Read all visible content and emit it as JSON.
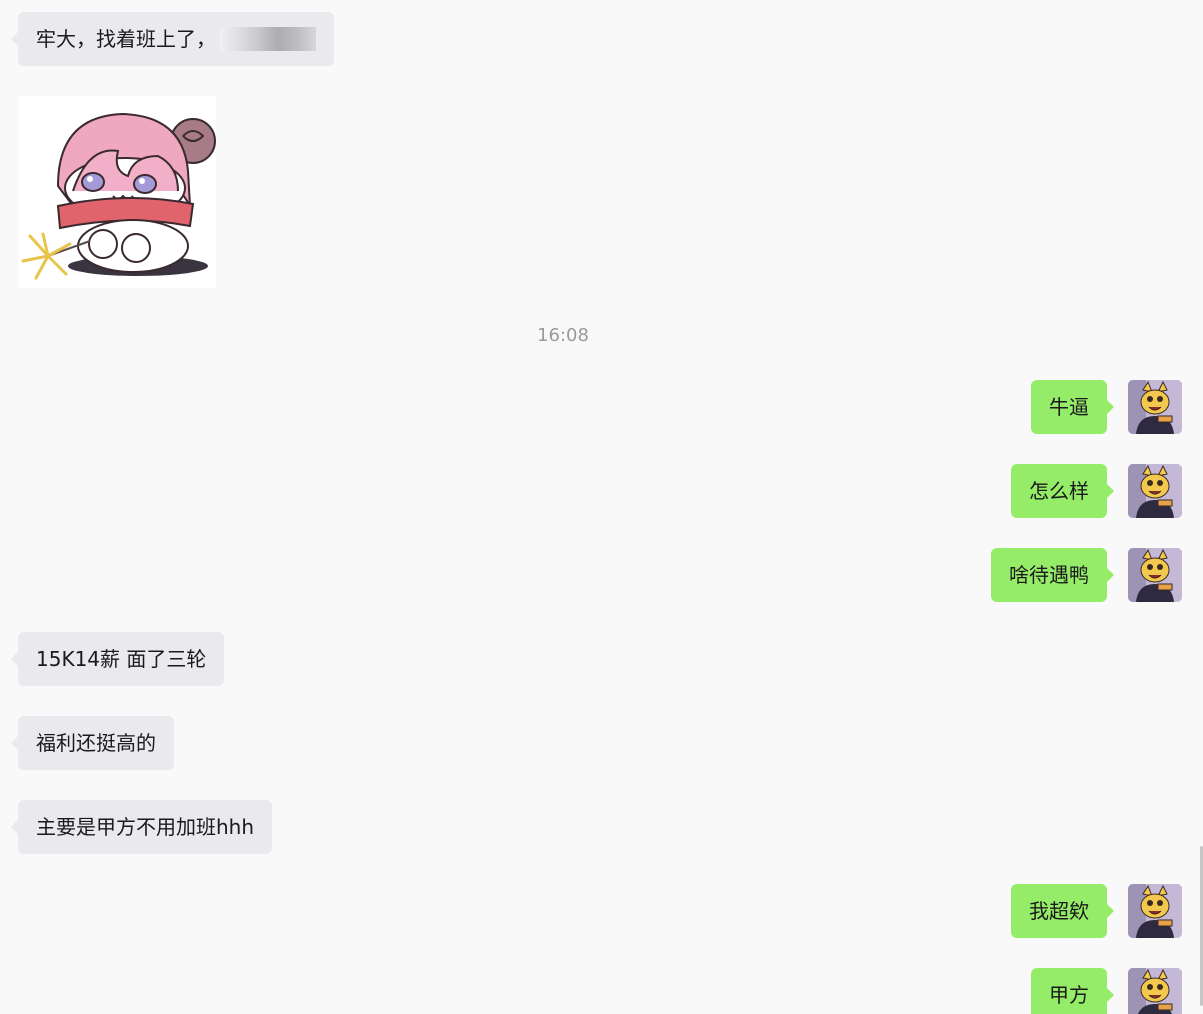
{
  "timestamp": "16:08",
  "messages": [
    {
      "side": "in",
      "text": "牢大，找着班上了，",
      "redacted": true
    },
    {
      "side": "in",
      "type": "sticker",
      "description": "pink-haired chibi girl with red scarf and sparkler"
    },
    {
      "side": "out",
      "text": "牛逼"
    },
    {
      "side": "out",
      "text": "怎么样"
    },
    {
      "side": "out",
      "text": "啥待遇鸭"
    },
    {
      "side": "in",
      "text": "15K14薪 面了三轮"
    },
    {
      "side": "in",
      "text": "福利还挺高的"
    },
    {
      "side": "in",
      "text": "主要是甲方不用加班hhh"
    },
    {
      "side": "out",
      "text": "我超欸"
    },
    {
      "side": "out",
      "text": "甲方"
    }
  ],
  "colors": {
    "background": "#f9f9f9",
    "incoming_bubble": "#eaeaee",
    "outgoing_bubble": "#95ec69",
    "timestamp_text": "#9a9a9a"
  },
  "icons": {
    "self_avatar": "cartoon-cat-avatar-icon"
  }
}
